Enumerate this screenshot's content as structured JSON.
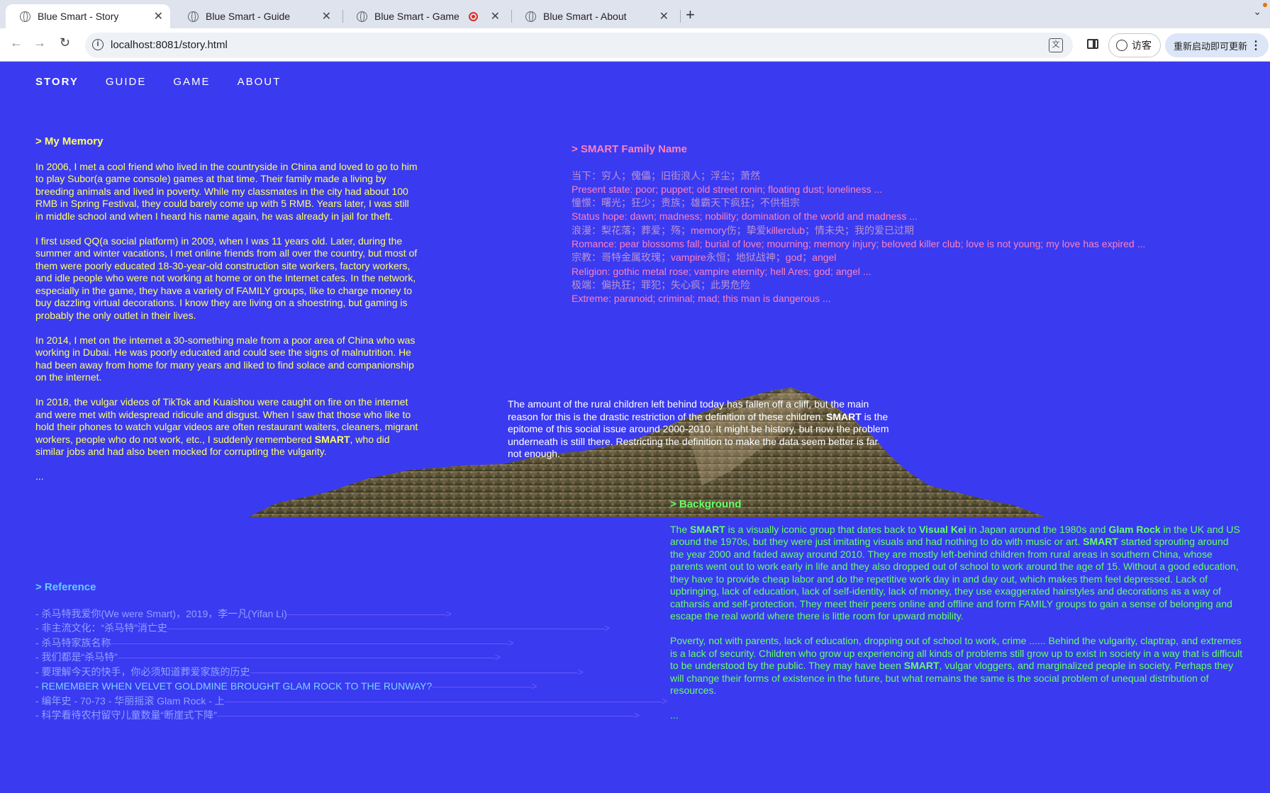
{
  "browser": {
    "tabs": [
      {
        "title": "Blue Smart - Story",
        "active": true
      },
      {
        "title": "Blue Smart - Guide",
        "active": false
      },
      {
        "title": "Blue Smart - Game",
        "active": false
      },
      {
        "title": "Blue Smart - About",
        "active": false
      }
    ],
    "close_glyph": "✕",
    "new_tab_glyph": "+",
    "url": "localhost:8081/story.html",
    "guest_label": "访客",
    "update_label": "重新启动即可更新"
  },
  "nav": {
    "story": "STORY",
    "guide": "GUIDE",
    "game": "GAME",
    "about": "ABOUT"
  },
  "memory": {
    "heading": "> My Memory",
    "p1": "In 2006, I met a cool friend who lived in the countryside in China and loved to go to him to play Subor(a game console) games at that time. Their family made a living by breeding animals and lived in poverty. While my classmates in the city had about 100 RMB in Spring Festival, they could barely come up with 5 RMB. Years later, I was still in middle school and when I heard his name again, he was already in jail for theft.",
    "p2": "I first used QQ(a social platform) in 2009, when I was 11 years old. Later, during the summer and winter vacations, I met online friends from all over the country, but most of them were poorly educated 18-30-year-old construction site workers, factory workers, and idle people who were not working at home or on the Internet cafes. In the network, especially in the game, they have a variety of FAMILY groups, like to charge money to buy dazzling virtual decorations. I know they are living on a shoestring, but gaming is probably the only outlet in their lives.",
    "p3": "In 2014, I met on the internet a 30-something male from a poor area of China who was working in Dubai. He was poorly educated and could see the signs of malnutrition. He had been away from home for many years and liked to find solace and companionship on the internet.",
    "p4_a": "In 2018, the vulgar videos of TikTok and Kuaishou were caught on fire on the internet and were met with widespread ridicule and disgust. When I saw that those who like to hold their phones to watch vulgar videos are often restaurant waiters, cleaners, migrant workers, people who do not work, etc., I suddenly remembered ",
    "p4_b": "SMART",
    "p4_c": ", who did similar jobs and had also been mocked for corrupting the vulgarity.",
    "ellipsis": "..."
  },
  "family": {
    "heading": "> SMART Family Name",
    "l1": "当下：穷人；傀儡；旧街浪人；浮尘；萧然",
    "l2": "Present state: poor; puppet; old street ronin; floating dust; loneliness ...",
    "l3": "憧憬：曙光；狂少；贵族；雄霸天下疯狂；不供祖宗",
    "l4": "Status hope: dawn; madness; nobility; domination of the world and madness ...",
    "l5_a": "浪漫：梨花落；葬爱；殇；",
    "l5_b": "memory",
    "l5_c": "伤；挚爱",
    "l5_d": "killerclub",
    "l5_e": "；情未央；我的爱已过期",
    "l6": "Romance: pear blossoms fall; burial of love; mourning; memory injury; beloved killer club; love is not young; my love has expired ...",
    "l7_a": "宗教：哥特金属玫瑰；",
    "l7_b": "vampire",
    "l7_c": "永恒；地狱战神；",
    "l7_d": "god",
    "l7_e": "；",
    "l7_f": "angel",
    "l8": "Religion: gothic metal rose; vampire eternity; hell Ares; god; angel ...",
    "l9": "极端：偏执狂；罪犯；失心疯；此男危险",
    "l10": "Extreme: paranoid; criminal; mad; this man is dangerous ..."
  },
  "rural": {
    "a": "The amount of the rural children left behind today has fallen off a cliff, but the main reason for this is the drastic restriction of the definition of these children. ",
    "b": "SMART",
    "c": " is the epitome of this social issue around 2000-2010. It might be history, but now the problem underneath is still there. Restricting the definition to make the data seem better is far not enough."
  },
  "background": {
    "heading": "> Background",
    "p1_1": "The ",
    "p1_2": "SMART",
    "p1_3": " is a visually iconic group that dates back to ",
    "p1_4": "Visual Kei",
    "p1_5": " in Japan around the 1980s and ",
    "p1_6": "Glam Rock",
    "p1_7": " in the UK and US around the 1970s, but they were just imitating visuals and had nothing to do with music or art. ",
    "p1_8": "SMART",
    "p1_9": " started sprouting around the year 2000 and faded away around 2010. They are mostly left-behind children from rural areas in southern China, whose parents went out to work early in life and they also dropped out of school to work around the age of 15. Without a good education, they have to provide cheap labor and do the repetitive work day in and day out, which makes them feel depressed. Lack of upbringing, lack of education, lack of self-identity, lack of money, they use exaggerated hairstyles and decorations as a way of catharsis and self-protection. They meet their peers online and offline and form FAMILY groups to gain a sense of belonging and escape the real world where there is little room for upward mobility.",
    "p2_1": "Poverty, not with parents, lack of education, dropping out of school to work, crime ...... Behind the vulgarity, claptrap, and extremes is a lack of security. Children who grow up experiencing all kinds of problems still grow up to exist in society in a way that is difficult to be understood by the public. They may have been ",
    "p2_2": "SMART",
    "p2_3": ", vulgar vloggers, and marginalized people in society. Perhaps they will change their forms of existence in the future, but what remains the same is the social problem of unequal distribution of resources.",
    "ellipsis": "..."
  },
  "reference": {
    "heading": "> Reference",
    "items": [
      {
        "text": "- 杀马特我爱你(We were Smart)，2019，李一凡(Yifan Li)",
        "arrow": "————————————————>"
      },
      {
        "text": "- 非主流文化：“杀马特”消亡史",
        "arrow": "————————————————————————————————————————————>"
      },
      {
        "text": "- 杀马特家族名称",
        "arrow": "————————————————————————————————————————>"
      },
      {
        "text": "- 我们都是“杀马特”",
        "arrow": "——————————————————————————————————————>"
      },
      {
        "text": "- 要理解今天的快手，你必须知道葬爱家族的历史",
        "arrow": "—————————————————————————————————>"
      },
      {
        "text": "- REMEMBER WHEN VELVET GOLDMINE BROUGHT GLAM ROCK TO THE RUNWAY?",
        "arrow": "——————————>"
      },
      {
        "text": "- 编年史 - 70-73 - 华丽摇滚 Glam Rock - 上",
        "arrow": "————————————————————————————————————————————>"
      },
      {
        "text": "- 科学看待农村留守儿童数量“断崖式下降”",
        "arrow": "——————————————————————————————————————————>"
      }
    ]
  },
  "colors": {
    "page_bg": "#3a3af0",
    "memory": "#ffff66",
    "family": "#ff80c0",
    "background": "#66ff66",
    "reference": "#66ccff"
  }
}
